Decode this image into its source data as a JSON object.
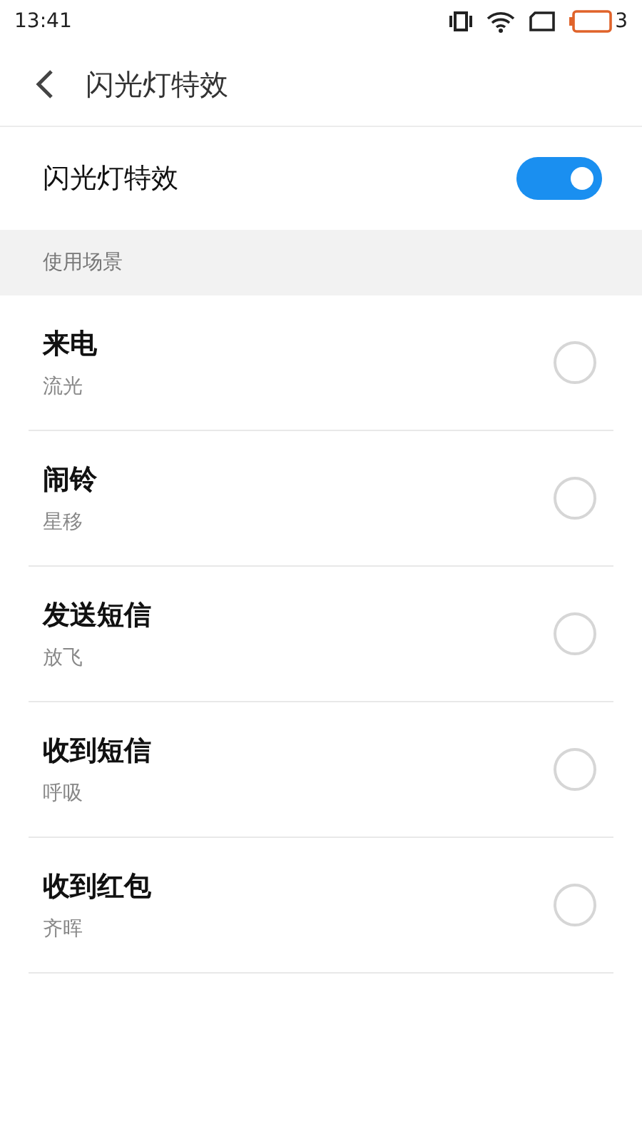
{
  "status_bar": {
    "time": "13:41",
    "battery_level_text": "3"
  },
  "header": {
    "title": "闪光灯特效"
  },
  "master_toggle": {
    "label": "闪光灯特效",
    "on": true
  },
  "section": {
    "title": "使用场景"
  },
  "scenes": [
    {
      "title": "来电",
      "subtitle": "流光",
      "selected": false
    },
    {
      "title": "闹铃",
      "subtitle": "星移",
      "selected": false
    },
    {
      "title": "发送短信",
      "subtitle": "放飞",
      "selected": false
    },
    {
      "title": "收到短信",
      "subtitle": "呼吸",
      "selected": false
    },
    {
      "title": "收到红包",
      "subtitle": "齐晖",
      "selected": false
    }
  ]
}
